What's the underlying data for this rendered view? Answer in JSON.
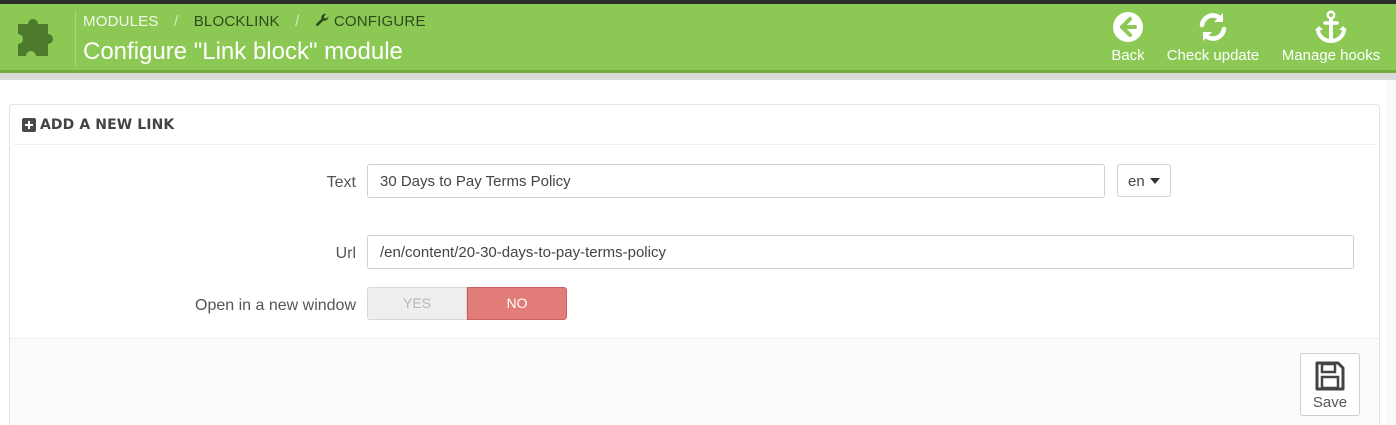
{
  "header": {
    "breadcrumb": [
      "MODULES",
      "BLOCKLINK",
      "CONFIGURE"
    ],
    "breadcrumb_sep": "/",
    "title": "Configure \"Link block\" module",
    "toolbar": [
      {
        "label": "Back",
        "icon": "arrow-left-circle-icon"
      },
      {
        "label": "Check update",
        "icon": "refresh-icon"
      },
      {
        "label": "Manage hooks",
        "icon": "anchor-icon"
      }
    ],
    "brand_color": "#8bc954"
  },
  "panel": {
    "heading": "ADD A NEW LINK",
    "heading_icon": "plus-square-icon",
    "fields": {
      "text": {
        "label": "Text",
        "value": "30 Days to Pay Terms Policy"
      },
      "language": {
        "value": "en"
      },
      "url": {
        "label": "Url",
        "value": "/en/content/20-30-days-to-pay-terms-policy"
      },
      "new_window": {
        "label": "Open in a new window",
        "options": [
          "YES",
          "NO"
        ],
        "selected": "NO"
      }
    },
    "save_label": "Save",
    "save_icon": "floppy-disk-icon"
  },
  "colors": {
    "switch_no": "#e27c79",
    "switch_yes": "#eeeeee"
  }
}
